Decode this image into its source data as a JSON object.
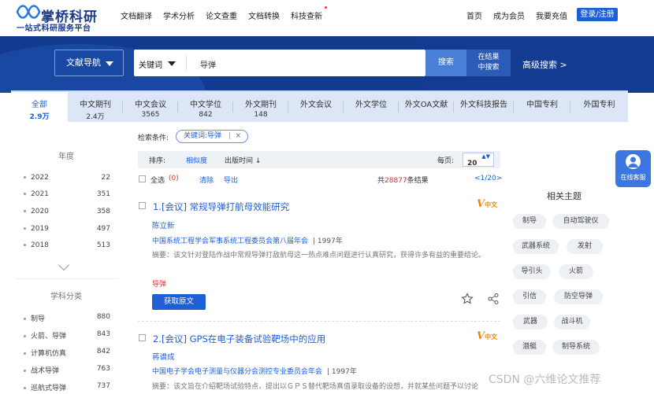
{
  "brand": {
    "name": "掌桥科研",
    "slogan": "一站式科研服务平台"
  },
  "topnav": [
    "文档翻译",
    "学术分析",
    "论文查重",
    "文档转换",
    "科技查新"
  ],
  "rightnav": [
    "首页",
    "成为会员",
    "我要充值"
  ],
  "login_label": "登录/注册",
  "search": {
    "nav_dropdown": "文献导航",
    "field": "关键词",
    "query": "导弹",
    "button": "搜索",
    "in_results_line1": "在结果",
    "in_results_line2": "中搜索",
    "advanced": "高级搜索 >"
  },
  "tabs": [
    {
      "label": "全部",
      "count": "2.9万"
    },
    {
      "label": "中文期刊",
      "count": "2.4万"
    },
    {
      "label": "中文会议",
      "count": "3565"
    },
    {
      "label": "中文学位",
      "count": "842"
    },
    {
      "label": "外文期刊",
      "count": "148"
    },
    {
      "label": "外文会议",
      "count": ""
    },
    {
      "label": "外文学位",
      "count": ""
    },
    {
      "label": "外文OA文献",
      "count": ""
    },
    {
      "label": "外文科技报告",
      "count": ""
    },
    {
      "label": "中国专利",
      "count": ""
    },
    {
      "label": "外国专利",
      "count": ""
    }
  ],
  "sidebar": {
    "year_title": "年度",
    "years": [
      {
        "label": "2022",
        "count": "22"
      },
      {
        "label": "2021",
        "count": "351"
      },
      {
        "label": "2020",
        "count": "358"
      },
      {
        "label": "2019",
        "count": "497"
      },
      {
        "label": "2018",
        "count": "513"
      }
    ],
    "subject_title": "学科分类",
    "subjects": [
      {
        "label": "制导",
        "count": "880"
      },
      {
        "label": "火箭、导弹",
        "count": "843"
      },
      {
        "label": "计算机仿真",
        "count": "842"
      },
      {
        "label": "战术导弹",
        "count": "763"
      },
      {
        "label": "巡航式导弹",
        "count": "737"
      }
    ]
  },
  "conditions": {
    "label": "检索条件:",
    "chip": "关键词:导弹",
    "chip_sep": "|",
    "chip_close": "×"
  },
  "sortbar": {
    "sort_label": "排序:",
    "relevance": "相似度",
    "pubtime": "出版时间 ↓",
    "perpage_label": "每页:",
    "perpage_value": "20",
    "perpage_arrows": "▲▼"
  },
  "selection": {
    "select_all": "全选",
    "selected_count": "(0)",
    "clear": "清除",
    "export": "导出",
    "total_prefix": "共",
    "total_count": "28877",
    "total_suffix": "条结果",
    "pager": "<1/20>"
  },
  "results": [
    {
      "title": "1.[会议] 常规导弹打航母效能研究",
      "author": "陈立新",
      "source": "中国系统工程学会军事系统工程委员会第八届年会",
      "year": "1997年",
      "abstract": "摘要：该文针对登陆作战中常规导弹打敌航母这一热点难点问题进行认真研究，获得许多有益的重要结论。",
      "keyword": "导弹",
      "button": "获取原文",
      "badge": "中文"
    },
    {
      "title": "2.[会议] GPS在电子装备试验靶场中的应用",
      "author": "蒋谱成",
      "source": "中国电子学会电子测量与仪器分会测控专业委员会年会",
      "year": "1997年",
      "abstract": "摘要：该文旨在介绍靶场试验特点，提出以ＧＰＳ替代靶场真值录取设备的设想，并就某些问题予以讨论",
      "keyword": "",
      "button": "",
      "badge": "中文"
    }
  ],
  "related": {
    "title": "相关主题",
    "tags": [
      "制导",
      "自动驾驶仪",
      "武器系统",
      "发射",
      "导引头",
      "火箭",
      "引信",
      "防空导弹",
      "武器",
      "战斗机",
      "潜艇",
      "制导系统"
    ]
  },
  "service": "在线客服",
  "watermark": "CSDN @六维论文推荐",
  "colors": {
    "brand_blue": "#1e5fd6",
    "hero_navy": "#123a8e",
    "highlight_red": "#e33333"
  }
}
